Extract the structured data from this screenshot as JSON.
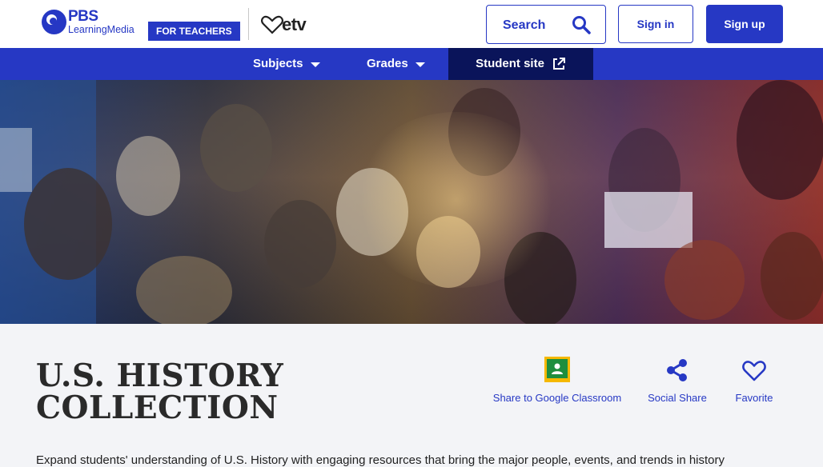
{
  "header": {
    "logo": {
      "pbs": "PBS",
      "learning_media": "LearningMedia"
    },
    "audience_badge": "FOR TEACHERS",
    "partner_logo": "etv",
    "search": {
      "label": "Search",
      "icon": "search-icon"
    },
    "sign_in": "Sign in",
    "sign_up": "Sign up"
  },
  "nav": {
    "items": [
      {
        "label": "Subjects"
      },
      {
        "label": "Grades"
      },
      {
        "label": "Student site"
      }
    ]
  },
  "collection": {
    "title_line1": "U.S. HISTORY",
    "title_line2": "COLLECTION",
    "actions": [
      {
        "label": "Share to Google Classroom",
        "icon": "google-classroom-icon"
      },
      {
        "label": "Social Share",
        "icon": "share-icon"
      },
      {
        "label": "Favorite",
        "icon": "heart-icon"
      }
    ],
    "description": "Expand students' understanding of U.S. History with engaging resources that bring the major people, events, and trends in history"
  },
  "colors": {
    "brand_blue": "#2638c4",
    "nav_active": "#0a145a",
    "classroom_green": "#1e8e3e",
    "classroom_yellow": "#f5b800"
  }
}
